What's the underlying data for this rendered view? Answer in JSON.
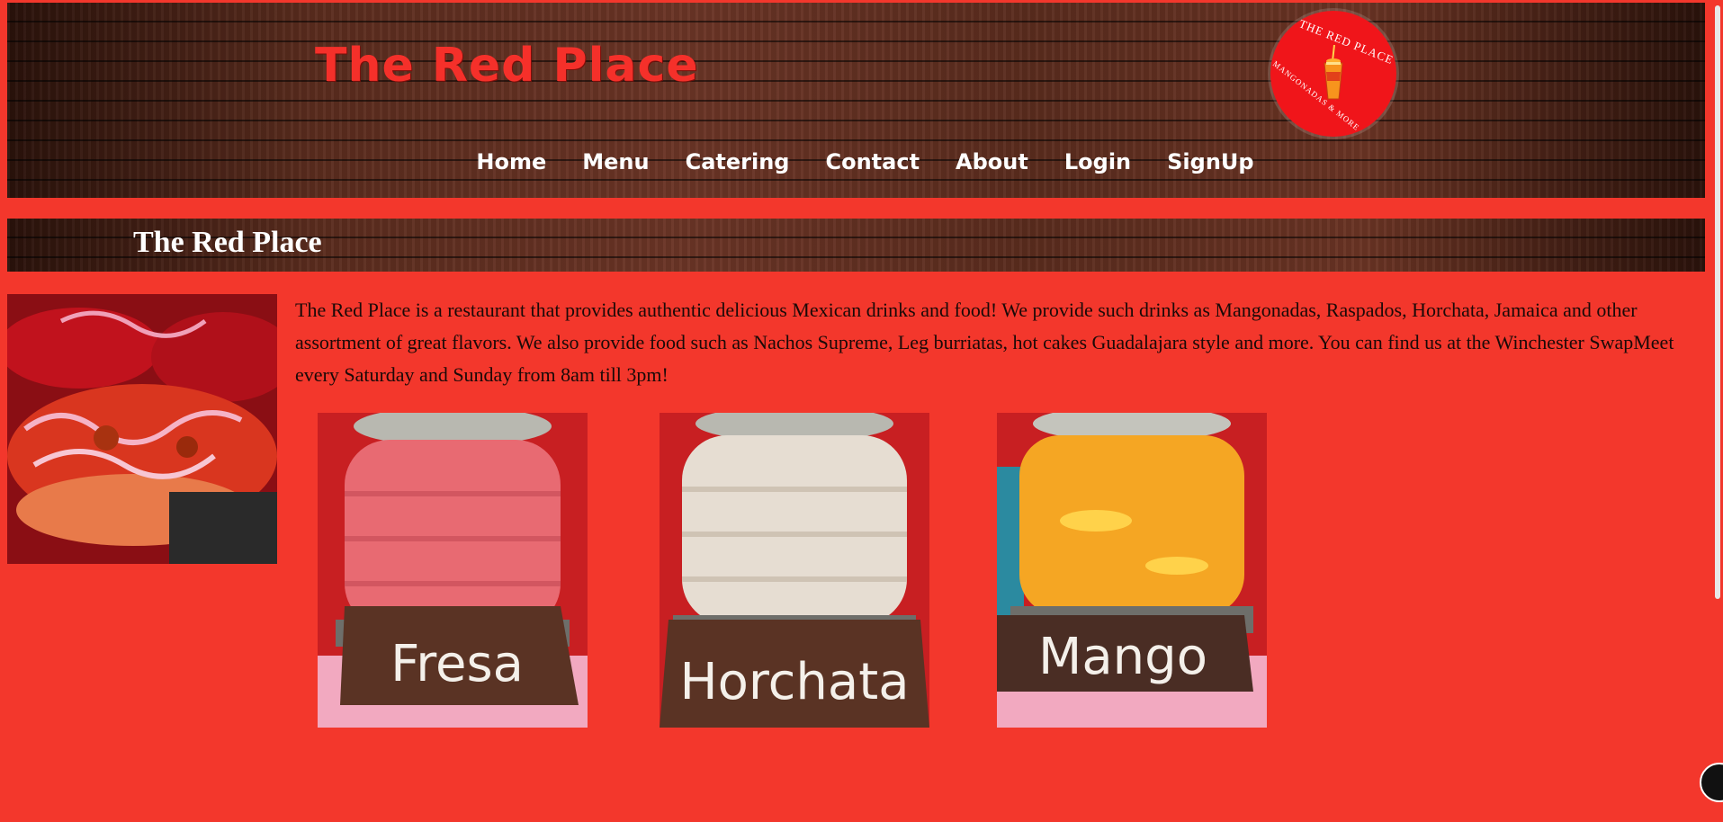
{
  "header": {
    "site_title": "The Red Place",
    "logo": {
      "top_text": "THE RED PLACE",
      "bottom_text": "MANGONADAS & MORE",
      "icon": "drink-cup-icon"
    },
    "nav": [
      "Home",
      "Menu",
      "Catering",
      "Contact",
      "About",
      "Login",
      "SignUp"
    ]
  },
  "section": {
    "title": "The Red Place"
  },
  "intro": {
    "text": "The Red Place is a restaurant that provides authentic delicious Mexican drinks and food! We provide such drinks as Mangonadas, Raspados, Horchata, Jamaica and other assortment of great flavors. We also provide food such as Nachos Supreme, Leg burriatas, hot cakes Guadalajara style and more. You can find us at the Winchester SwapMeet every Saturday and Sunday from 8am till 3pm!"
  },
  "drinks": [
    {
      "label": "Fresa",
      "liquid_color": "#e86a72"
    },
    {
      "label": "Horchata",
      "liquid_color": "#e6ddd2"
    },
    {
      "label": "Mango",
      "liquid_color": "#f5a623"
    }
  ],
  "colors": {
    "page_background": "#f3372c",
    "title_red": "#f5302a",
    "logo_red": "#f0151a",
    "wood_dark": "#4a2418"
  }
}
